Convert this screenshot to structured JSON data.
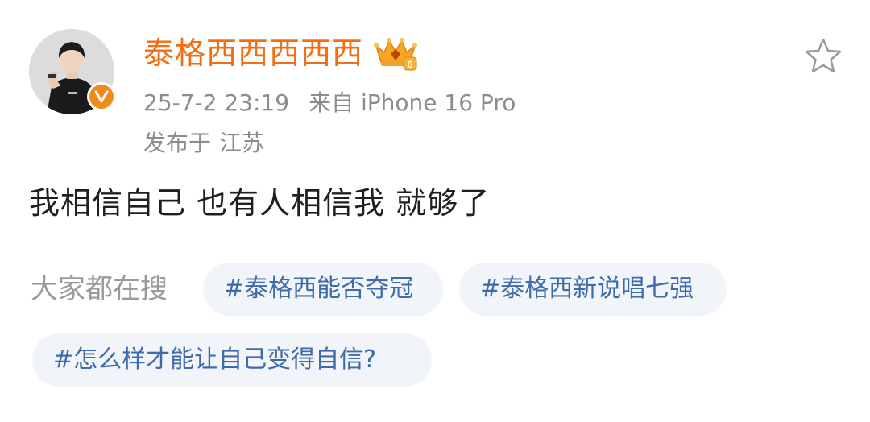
{
  "post": {
    "username": "泰格西西西西西",
    "level_badge": "6",
    "timestamp": "25-7-2 23:19",
    "source_prefix": "来自",
    "device": "iPhone 16 Pro",
    "location_prefix": "发布于",
    "location": "江苏",
    "content": "我相信自己 也有人相信我 就够了"
  },
  "search": {
    "label": "大家都在搜",
    "topics": [
      {
        "text": "#泰格西能否夺冠"
      },
      {
        "text": "#泰格西新说唱七强"
      },
      {
        "text": "#怎么样才能让自己变得自信?"
      }
    ]
  },
  "icons": {
    "avatar": "user-avatar",
    "verified": "verified-v-icon",
    "crown": "crown-level-icon",
    "favorite": "star-outline-icon"
  },
  "colors": {
    "username": "#f36d12",
    "meta_text": "#8c8c8c",
    "body_text": "#1f1f1f",
    "topic_text": "#3f6ba8",
    "chip_bg": "#f1f4f8",
    "verified_bg": "#f08a1d"
  }
}
